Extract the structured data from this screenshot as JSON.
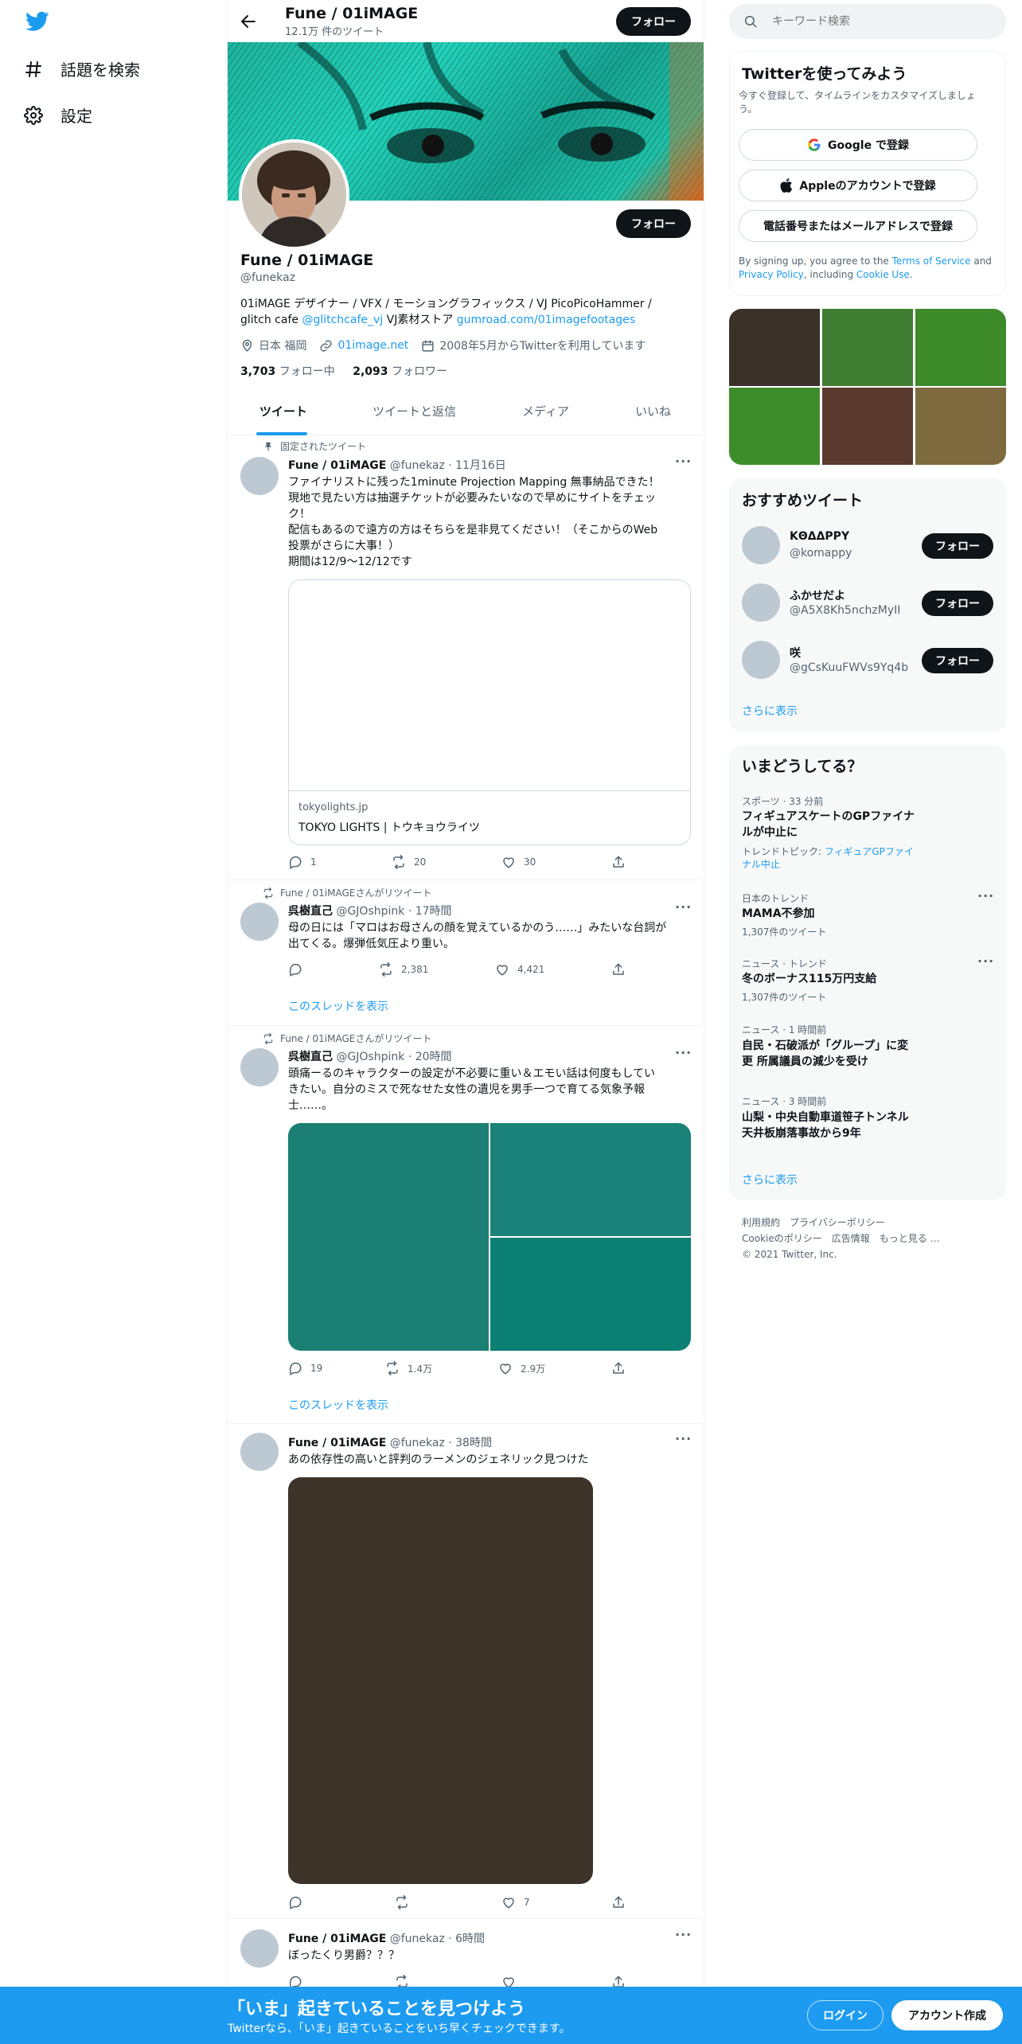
{
  "sidebar": {
    "explore": "話題を検索",
    "settings": "設定"
  },
  "header": {
    "name": "Fune / 01iMAGE",
    "tweet_count": "12.1万 件のツイート",
    "follow": "フォロー"
  },
  "profile": {
    "name": "Fune / 01iMAGE",
    "handle": "@funekaz",
    "follow": "フォロー",
    "bio1": "01iMAGE デザイナー / VFX / モーショングラフィックス / VJ PicoPicoHammer /",
    "bio2_pre": "glitch cafe ",
    "bio2_link1": "@glitchcafe_vj",
    "bio2_mid": " VJ素材ストア ",
    "bio2_link2": "gumroad.com/01imagefootages",
    "location": "日本 福岡",
    "website": "01image.net",
    "joined": "2008年5月からTwitterを利用しています",
    "following_count": "3,703",
    "following_label": "フォロー中",
    "followers_count": "2,093",
    "followers_label": "フォロワー"
  },
  "tabs": [
    "ツイート",
    "ツイートと返信",
    "メディア",
    "いいね"
  ],
  "tweets": {
    "pinned_label": "固定されたツイート",
    "t1": {
      "name": "Fune / 01iMAGE",
      "meta": "@funekaz · 11月16日",
      "lines": [
        "ファイナリストに残った1minute Projection Mapping 無事納品できた！",
        "現地で見たい方は抽選チケットが必要みたいなので早めにサイトをチェッ",
        "ク！",
        "配信もあるので遠方の方はそちらを是非見てください！（そこからのWeb",
        "投票がさらに大事！）",
        "期間は12/9〜12/12です"
      ],
      "card_domain": "tokyolights.jp",
      "card_title": "TOKYO LIGHTS | トウキョウライツ",
      "replies": "1",
      "retweets": "20",
      "likes": "30"
    },
    "rt_label": "Fune / 01iMAGEさんがリツイート",
    "t2": {
      "name": "呉樹直己",
      "meta": "@GJOshpink · 17時間",
      "lines": [
        "母の日には「マロはお母さんの顔を覚えているかのう……」みたいな台詞が",
        "出てくる。爆弾低気圧より重い。"
      ],
      "replies": "",
      "retweets": "2,381",
      "likes": "4,421",
      "thread": "このスレッドを表示"
    },
    "t3": {
      "name": "呉樹直己",
      "meta": "@GJOshpink · 20時間",
      "lines": [
        "頭痛ーるのキャラクターの設定が不必要に重い＆エモい話は何度もしてい",
        "きたい。自分のミスで死なせた女性の遺児を男手一つで育てる気象予報",
        "士……。"
      ],
      "replies": "19",
      "retweets": "1.4万",
      "likes": "2.9万",
      "thread": "このスレッドを表示"
    },
    "t4": {
      "name": "Fune / 01iMAGE",
      "meta": "@funekaz · 38時間",
      "lines": [
        "あの依存性の高いと評判のラーメンのジェネリック見つけた"
      ],
      "replies": "",
      "retweets": "",
      "likes": "7"
    },
    "t5": {
      "name": "Fune / 01iMAGE",
      "meta": "@funekaz · 6時間",
      "lines": [
        "ぼったくり男爵？？？"
      ]
    }
  },
  "search": {
    "placeholder": "キーワード検索"
  },
  "signup": {
    "title": "Twitterを使ってみよう",
    "sub1": "今すぐ登録して、タイムラインをカスタマイズしましょ",
    "sub2": "う。",
    "google": "Google で登録",
    "apple": "Appleのアカウントで登録",
    "phone": "電話番号またはメールアドレスで登録",
    "terms1_pre": "By signing up, you agree to the ",
    "terms1_link": "Terms of Service",
    "terms1_post": " and",
    "terms2_link1": "Privacy Policy",
    "terms2_mid": ", including ",
    "terms2_link2": "Cookie Use",
    "terms2_post": "."
  },
  "media_grid_colors": [
    "#3a3128",
    "#3f7d32",
    "#3c8a2a",
    "#3d8e2b",
    "#5a3a2e",
    "#7d6a3f"
  ],
  "recommend": {
    "title": "おすすめツイート",
    "users": [
      {
        "name": "ΚΘΔΔΡΡΥ",
        "handle": "@komappy",
        "follow": "フォロー"
      },
      {
        "name": "ふかせだよ",
        "handle": "@A5X8Kh5nchzMyII",
        "follow": "フォロー"
      },
      {
        "name": "咲",
        "handle": "@gCsKuuFWVs9Yq4b",
        "follow": "フォロー"
      }
    ],
    "more": "さらに表示"
  },
  "trends": {
    "title": "いまどうしてる？",
    "items": [
      {
        "cat": "スポーツ · 33 分前",
        "title1": "フィギュアスケートのGPファイナ",
        "title2": "ルが中止に",
        "topic_pre": "トレンドトピック: ",
        "topic_link1": "フィギュアGPファイ",
        "topic_link2": "ナル中止"
      },
      {
        "cat": "日本のトレンド",
        "title1": "MAMA不参加",
        "count": "1,307件のツイート"
      },
      {
        "cat": "ニュース · トレンド",
        "title1": "冬のボーナス115万円支給",
        "count": "1,307件のツイート"
      },
      {
        "cat": "ニュース · 1 時間前",
        "title1": "自民・石破派が「グループ」に変",
        "title2": "更 所属議員の減少を受け"
      },
      {
        "cat": "ニュース · 3 時間前",
        "title1": "山梨・中央自動車道笹子トンネル",
        "title2": "天井板崩落事故から9年"
      }
    ],
    "more": "さらに表示"
  },
  "footer": {
    "line1a": "利用規約",
    "line1b": "プライバシーポリシー",
    "line2a": "Cookieのポリシー",
    "line2b": "広告情報",
    "line2c": "もっと見る …",
    "copyright": "© 2021 Twitter, Inc."
  },
  "bottom": {
    "title": "「いま」起きていることを見つけよう",
    "sub": "Twitterなら、「いま」起きていることをいち早くチェックできます。",
    "login": "ログイン",
    "signup": "アカウント作成"
  },
  "colors": {
    "brand": "#1d9bf0",
    "dark": "#0f1419",
    "gray": "#536471",
    "banner": "#1bc4ad"
  }
}
